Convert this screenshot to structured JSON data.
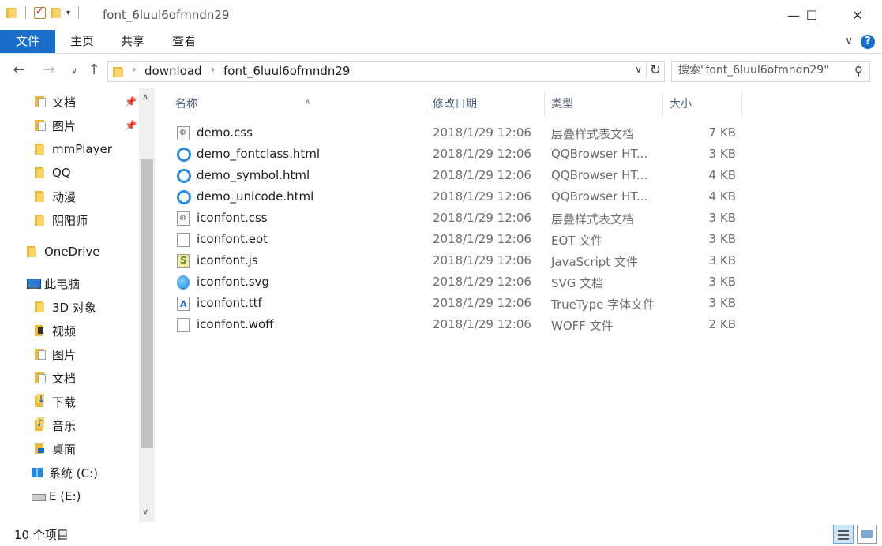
{
  "window": {
    "title": "font_6luul6ofmndn29",
    "minimize": "—",
    "maximize": "☐",
    "close": "✕"
  },
  "ribbon": {
    "tabs": [
      "文件",
      "主页",
      "共享",
      "查看"
    ],
    "expand_icon": "chevron-down-icon",
    "help_label": "?"
  },
  "address": {
    "crumbs": [
      "download",
      "font_6luul6ofmndn29"
    ],
    "search_placeholder": "搜索\"font_6luul6ofmndn29\""
  },
  "sidebar": {
    "quick_access": [
      {
        "label": "文档",
        "pinned": true
      },
      {
        "label": "图片",
        "pinned": true
      },
      {
        "label": "mmPlayer"
      },
      {
        "label": "QQ"
      },
      {
        "label": "动漫"
      },
      {
        "label": "阴阳师"
      }
    ],
    "onedrive": "OneDrive",
    "this_pc": "此电脑",
    "pc_items": [
      "3D 对象",
      "视频",
      "图片",
      "文档",
      "下载",
      "音乐",
      "桌面",
      "系统 (C:)",
      "E (E:)"
    ]
  },
  "columns": {
    "name": "名称",
    "date": "修改日期",
    "type": "类型",
    "size": "大小"
  },
  "files": [
    {
      "name": "demo.css",
      "date": "2018/1/29 12:06",
      "type": "层叠样式表文档",
      "size": "7 KB",
      "icon": "css-file-icon"
    },
    {
      "name": "demo_fontclass.html",
      "date": "2018/1/29 12:06",
      "type": "QQBrowser HT...",
      "size": "3 KB",
      "icon": "qqbrowser-html-icon"
    },
    {
      "name": "demo_symbol.html",
      "date": "2018/1/29 12:06",
      "type": "QQBrowser HT...",
      "size": "4 KB",
      "icon": "qqbrowser-html-icon"
    },
    {
      "name": "demo_unicode.html",
      "date": "2018/1/29 12:06",
      "type": "QQBrowser HT...",
      "size": "4 KB",
      "icon": "qqbrowser-html-icon"
    },
    {
      "name": "iconfont.css",
      "date": "2018/1/29 12:06",
      "type": "层叠样式表文档",
      "size": "3 KB",
      "icon": "css-file-icon"
    },
    {
      "name": "iconfont.eot",
      "date": "2018/1/29 12:06",
      "type": "EOT 文件",
      "size": "3 KB",
      "icon": "blank-file-icon"
    },
    {
      "name": "iconfont.js",
      "date": "2018/1/29 12:06",
      "type": "JavaScript 文件",
      "size": "3 KB",
      "icon": "js-file-icon"
    },
    {
      "name": "iconfont.svg",
      "date": "2018/1/29 12:06",
      "type": "SVG 文档",
      "size": "3 KB",
      "icon": "svg-file-icon"
    },
    {
      "name": "iconfont.ttf",
      "date": "2018/1/29 12:06",
      "type": "TrueType 字体文件",
      "size": "3 KB",
      "icon": "ttf-file-icon"
    },
    {
      "name": "iconfont.woff",
      "date": "2018/1/29 12:06",
      "type": "WOFF 文件",
      "size": "2 KB",
      "icon": "blank-file-icon"
    }
  ],
  "status": {
    "item_count": "10 个项目"
  },
  "colors": {
    "accent": "#1a6dc8",
    "folder": "#e8b93a"
  }
}
